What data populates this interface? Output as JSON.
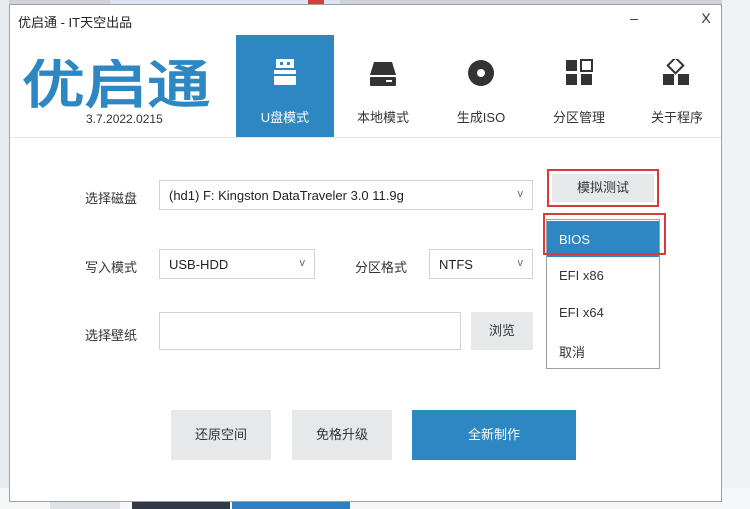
{
  "window": {
    "title": "优启通 - IT天空出品",
    "minimize": "–",
    "close": "X"
  },
  "header": {
    "logo_text": "优启通",
    "version": "3.7.2022.0215",
    "tabs": [
      {
        "label": "U盘模式",
        "icon": "usb-drive-icon",
        "active": true
      },
      {
        "label": "本地模式",
        "icon": "hard-disk-icon",
        "active": false
      },
      {
        "label": "生成ISO",
        "icon": "disc-icon",
        "active": false
      },
      {
        "label": "分区管理",
        "icon": "partition-grid-icon",
        "active": false
      },
      {
        "label": "关于程序",
        "icon": "cubes-icon",
        "active": false
      }
    ]
  },
  "form": {
    "disk_label": "选择磁盘",
    "disk_value": "(hd1) F: Kingston DataTraveler 3.0 11.9g",
    "write_mode_label": "写入模式",
    "write_mode_value": "USB-HDD",
    "partition_format_label": "分区格式",
    "partition_format_value": "NTFS",
    "wallpaper_label": "选择壁纸",
    "wallpaper_value": "",
    "browse_label": "浏览",
    "simulate_label": "模拟测试",
    "dropdown_arrow": "v"
  },
  "simulate_menu": {
    "items": [
      "BIOS",
      "EFI x86",
      "EFI x64",
      "取消"
    ],
    "selected": "BIOS"
  },
  "actions": {
    "restore_label": "还原空间",
    "upgrade_label": "免格升级",
    "create_label": "全新制作"
  },
  "colors": {
    "accent": "#2d87c3",
    "highlight": "#d93b3b"
  }
}
